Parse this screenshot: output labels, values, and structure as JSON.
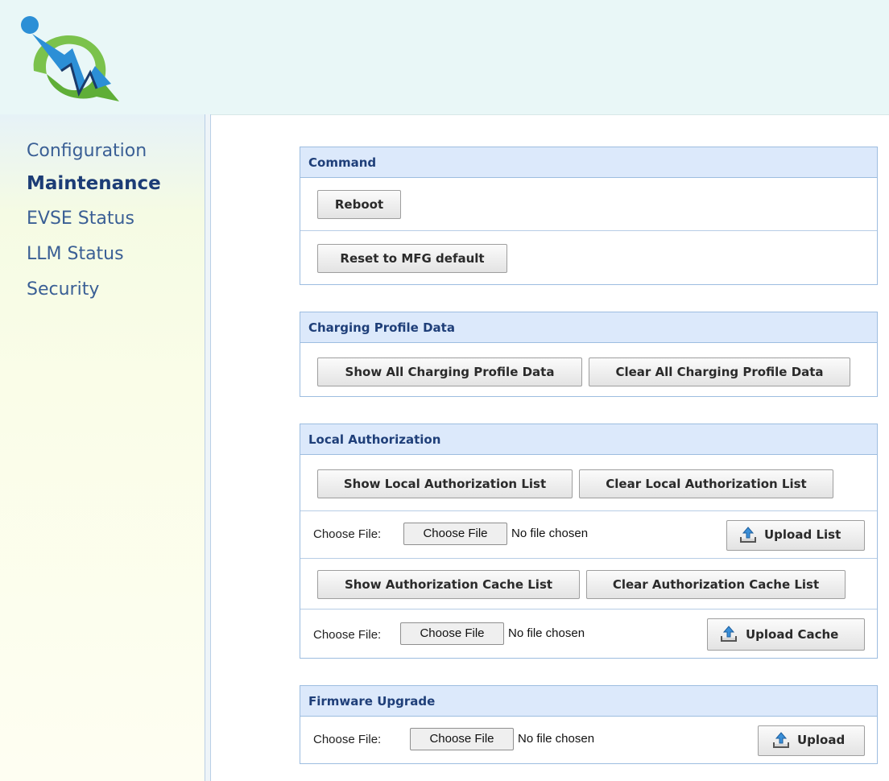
{
  "nav": {
    "items": [
      {
        "label": "Configuration",
        "active": false
      },
      {
        "label": "Maintenance",
        "active": true
      },
      {
        "label": "EVSE Status",
        "active": false
      },
      {
        "label": "LLM Status",
        "active": false
      },
      {
        "label": "Security",
        "active": false
      }
    ]
  },
  "command": {
    "title": "Command",
    "reboot_label": "Reboot",
    "reset_label": "Reset to MFG default"
  },
  "charging_profile": {
    "title": "Charging Profile Data",
    "show_label": "Show All Charging Profile Data",
    "clear_label": "Clear All Charging Profile Data"
  },
  "local_auth": {
    "title": "Local Authorization",
    "show_list_label": "Show Local Authorization List",
    "clear_list_label": "Clear Local Authorization List",
    "list_file": {
      "label": "Choose File:",
      "button": "Choose File",
      "status": "No file chosen",
      "upload_label": "Upload List"
    },
    "show_cache_label": "Show Authorization Cache List",
    "clear_cache_label": "Clear Authorization Cache List",
    "cache_file": {
      "label": "Choose File:",
      "button": "Choose File",
      "status": "No file chosen",
      "upload_label": "Upload Cache"
    }
  },
  "firmware": {
    "title": "Firmware Upgrade",
    "file": {
      "label": "Choose File:",
      "button": "Choose File",
      "status": "No file chosen",
      "upload_label": "Upload"
    }
  },
  "colors": {
    "panel_border": "#9dbde0",
    "panel_header": "#dce9fb",
    "nav_text": "#3a5f95",
    "nav_active": "#1c3c76",
    "header_bg": "#e9f7f7"
  },
  "icons": {
    "logo": "power-bolt-logo",
    "upload": "upload-tray-icon"
  }
}
